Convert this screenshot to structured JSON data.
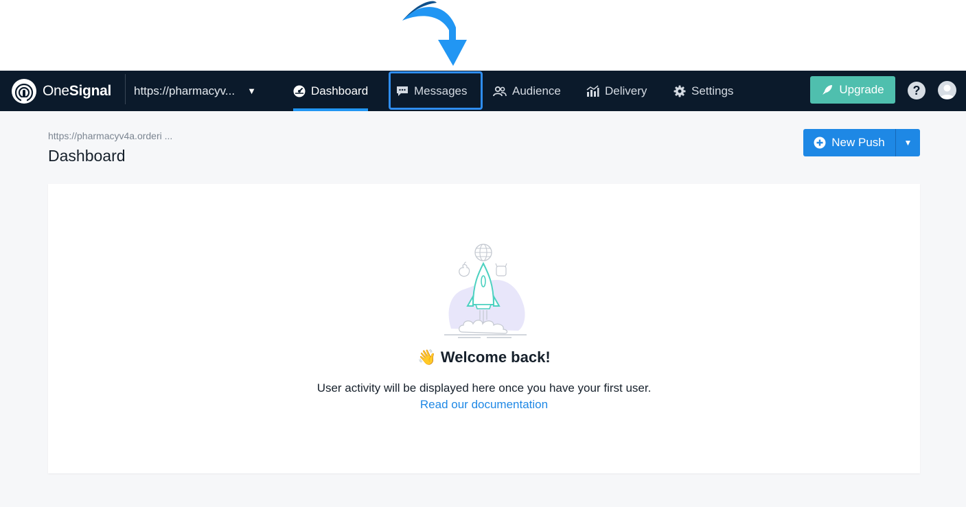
{
  "brand": {
    "name_light": "One",
    "name_bold": "Signal",
    "accent": "#2196f3",
    "navbar_bg": "#0b1a2b"
  },
  "app_selector": {
    "value": "https://pharmacyv...",
    "icon": "caret-down-icon"
  },
  "nav": {
    "items": [
      {
        "label": "Dashboard",
        "icon": "dashboard-gauge-icon",
        "active": true
      },
      {
        "label": "Messages",
        "icon": "chat-bubble-icon",
        "active": false
      },
      {
        "label": "Audience",
        "icon": "people-icon",
        "active": false
      },
      {
        "label": "Delivery",
        "icon": "bar-chart-icon",
        "active": false
      },
      {
        "label": "Settings",
        "icon": "gear-icon",
        "active": false
      }
    ]
  },
  "header_actions": {
    "upgrade_label": "Upgrade",
    "upgrade_color": "#4fbfae",
    "help_icon": "question-icon",
    "help_glyph": "?",
    "avatar_icon": "user-avatar-icon"
  },
  "page": {
    "breadcrumb": "https://pharmacyv4a.orderi ...",
    "title": "Dashboard",
    "new_push_label": "New Push",
    "new_push_caret": "▼",
    "new_push_color": "#1e88e5"
  },
  "empty_state": {
    "wave_emoji": "👋",
    "heading": "Welcome back!",
    "message": "User activity will be displayed here once you have your first user.",
    "link": "Read our documentation"
  },
  "annotation": {
    "highlight_target": "Messages",
    "arrow_color": "#2196f3"
  }
}
